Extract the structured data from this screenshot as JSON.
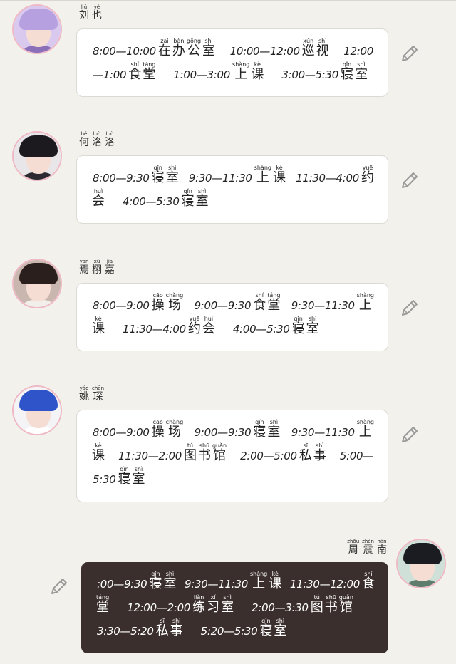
{
  "messages": [
    {
      "side": "left",
      "sender": {
        "name": [
          {
            "py": "liú",
            "hz": "刘"
          },
          {
            "py": "yě",
            "hz": "也"
          }
        ]
      },
      "avatar": {
        "bg": "#d9c9ef",
        "hair": "#b6a0e0",
        "clothes": "#8b6fb8"
      },
      "lines": [
        [
          {
            "t": "8:00—10:00"
          },
          {
            "py": "zài",
            "hz": "在"
          },
          {
            "py": "bàn",
            "hz": "办"
          },
          {
            "py": "gōng",
            "hz": "公"
          },
          {
            "py": "shì",
            "hz": "室"
          },
          {
            "gap": true
          },
          {
            "t": "10:00—12:00"
          },
          {
            "py": "xún",
            "hz": "巡"
          },
          {
            "py": "shì",
            "hz": "视"
          },
          {
            "gap": true
          },
          {
            "t": "12:00"
          }
        ],
        [
          {
            "t": "—1:00"
          },
          {
            "py": "shí",
            "hz": "食"
          },
          {
            "py": "táng",
            "hz": "堂"
          },
          {
            "gap": true
          },
          {
            "t": "1:00—3:00"
          },
          {
            "py": "shàng",
            "hz": "上"
          },
          {
            "py": "kè",
            "hz": "课"
          },
          {
            "gap": true
          },
          {
            "t": "3:00—5:30"
          },
          {
            "py": "qǐn",
            "hz": "寝"
          },
          {
            "py": "shì",
            "hz": "室"
          }
        ]
      ]
    },
    {
      "side": "left",
      "sender": {
        "name": [
          {
            "py": "hé",
            "hz": "何"
          },
          {
            "py": "luò",
            "hz": "洛"
          },
          {
            "py": "luò",
            "hz": "洛"
          }
        ]
      },
      "avatar": {
        "bg": "#e9e6ea",
        "hair": "#1c1a1f",
        "clothes": "#2c2a30"
      },
      "lines": [
        [
          {
            "t": "8:00—9:30"
          },
          {
            "py": "qǐn",
            "hz": "寝"
          },
          {
            "py": "shì",
            "hz": "室"
          },
          {
            "gap": true
          },
          {
            "t": "9:30—11:30"
          },
          {
            "py": "shàng",
            "hz": "上"
          },
          {
            "py": "kè",
            "hz": "课"
          },
          {
            "gap": true
          },
          {
            "t": "11:30—4:00"
          },
          {
            "py": "yuē",
            "hz": "约"
          }
        ],
        [
          {
            "py": "huì",
            "hz": "会"
          },
          {
            "gap": true
          },
          {
            "t": "4:00—5:30"
          },
          {
            "py": "qǐn",
            "hz": "寝"
          },
          {
            "py": "shì",
            "hz": "室"
          }
        ]
      ]
    },
    {
      "side": "left",
      "sender": {
        "name": [
          {
            "py": "yān",
            "hz": "焉"
          },
          {
            "py": "xǔ",
            "hz": "栩"
          },
          {
            "py": "jiā",
            "hz": "嘉"
          }
        ]
      },
      "avatar": {
        "bg": "#c9b6ae",
        "hair": "#2a1f1c",
        "clothes": "#f2eeea"
      },
      "lines": [
        [
          {
            "t": "8:00—9:00"
          },
          {
            "py": "cāo",
            "hz": "操"
          },
          {
            "py": "chǎng",
            "hz": "场"
          },
          {
            "gap": true
          },
          {
            "t": "9:00—9:30"
          },
          {
            "py": "shí",
            "hz": "食"
          },
          {
            "py": "táng",
            "hz": "堂"
          },
          {
            "gap": true
          },
          {
            "t": "9:30—11:30"
          },
          {
            "py": "shàng",
            "hz": "上"
          }
        ],
        [
          {
            "py": "kè",
            "hz": "课"
          },
          {
            "gap": true
          },
          {
            "t": "11:30—4:00"
          },
          {
            "py": "yuē",
            "hz": "约"
          },
          {
            "py": "huì",
            "hz": "会"
          },
          {
            "gap": true
          },
          {
            "t": "4:00—5:30"
          },
          {
            "py": "qǐn",
            "hz": "寝"
          },
          {
            "py": "shì",
            "hz": "室"
          }
        ]
      ]
    },
    {
      "side": "left",
      "sender": {
        "name": [
          {
            "py": "yáo",
            "hz": "姚"
          },
          {
            "py": "chēn",
            "hz": "琛"
          }
        ]
      },
      "avatar": {
        "bg": "#f4f4f6",
        "hair": "#2f54c9",
        "clothes": "#ffffff"
      },
      "lines": [
        [
          {
            "t": "8:00—9:00"
          },
          {
            "py": "cāo",
            "hz": "操"
          },
          {
            "py": "chǎng",
            "hz": "场"
          },
          {
            "gap": true
          },
          {
            "t": "9:00—9:30"
          },
          {
            "py": "qǐn",
            "hz": "寝"
          },
          {
            "py": "shì",
            "hz": "室"
          },
          {
            "gap": true
          },
          {
            "t": "9:30—11:30"
          },
          {
            "py": "shàng",
            "hz": "上"
          }
        ],
        [
          {
            "py": "kè",
            "hz": "课"
          },
          {
            "gap": true
          },
          {
            "t": "11:30—2:00"
          },
          {
            "py": "tú",
            "hz": "图"
          },
          {
            "py": "shū",
            "hz": "书"
          },
          {
            "py": "guǎn",
            "hz": "馆"
          },
          {
            "gap": true
          },
          {
            "t": "2:00—5:00"
          },
          {
            "py": "sī",
            "hz": "私"
          },
          {
            "py": "shì",
            "hz": "事"
          },
          {
            "gap": true
          },
          {
            "t": "5:00—"
          }
        ],
        [
          {
            "t": "5:30"
          },
          {
            "py": "qǐn",
            "hz": "寝"
          },
          {
            "py": "shì",
            "hz": "室"
          }
        ]
      ]
    },
    {
      "side": "right",
      "sender": {
        "name": [
          {
            "py": "zhōu",
            "hz": "周"
          },
          {
            "py": "zhèn",
            "hz": "震"
          },
          {
            "py": "nán",
            "hz": "南"
          }
        ]
      },
      "avatar": {
        "bg": "#cfe0d8",
        "hair": "#1b1b22",
        "clothes": "#5f7d6d"
      },
      "lines": [
        [
          {
            "t": ":00—9:30"
          },
          {
            "py": "qǐn",
            "hz": "寝"
          },
          {
            "py": "shì",
            "hz": "室"
          },
          {
            "gap": true
          },
          {
            "t": "9:30—11:30"
          },
          {
            "py": "shàng",
            "hz": "上"
          },
          {
            "py": "kè",
            "hz": "课"
          },
          {
            "gap": true
          },
          {
            "t": "11:30—12:00"
          },
          {
            "py": "shí",
            "hz": "食"
          }
        ],
        [
          {
            "py": "táng",
            "hz": "堂"
          },
          {
            "gap": true
          },
          {
            "t": "12:00—2:00"
          },
          {
            "py": "liàn",
            "hz": "练"
          },
          {
            "py": "xí",
            "hz": "习"
          },
          {
            "py": "shì",
            "hz": "室"
          },
          {
            "gap": true
          },
          {
            "t": "2:00—3:30"
          },
          {
            "py": "tú",
            "hz": "图"
          },
          {
            "py": "shū",
            "hz": "书"
          },
          {
            "py": "guǎn",
            "hz": "馆"
          }
        ],
        [
          {
            "t": "3:30—5:20"
          },
          {
            "py": "sī",
            "hz": "私"
          },
          {
            "py": "shì",
            "hz": "事"
          },
          {
            "gap": true
          },
          {
            "t": "5:20—5:30"
          },
          {
            "py": "qǐn",
            "hz": "寝"
          },
          {
            "py": "shì",
            "hz": "室"
          }
        ]
      ]
    }
  ],
  "colors": {
    "background": "#f2f1ec",
    "bubble_light": "#ffffff",
    "bubble_dark": "#3b2f2d",
    "avatar_ring": "#efb9c6",
    "edit_icon": "#9a9a9a"
  },
  "icons": {
    "edit": "pencil-icon"
  }
}
